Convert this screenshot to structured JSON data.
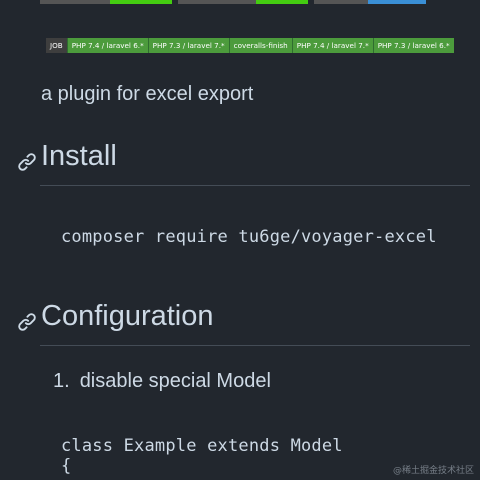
{
  "job_strip": {
    "label": "JOB",
    "items": [
      "PHP 7.4 / laravel 6.*",
      "PHP 7.3 / laravel 7.*",
      "coveralls-finish",
      "PHP 7.4 / laravel 7.*",
      "PHP 7.3 / laravel 6.*"
    ]
  },
  "description": "a plugin for excel export",
  "sections": {
    "install": {
      "title": "Install",
      "code": "composer require tu6ge/voyager-excel"
    },
    "configuration": {
      "title": "Configuration",
      "steps": [
        {
          "number": "1.",
          "text": "disable special Model"
        }
      ],
      "code_lines": [
        "class Example extends Model",
        "{"
      ]
    }
  },
  "watermark": "@稀土掘金技术社区",
  "colors": {
    "background": "#22272e",
    "text": "#cdd9e5",
    "badge_green": "#4c9b3c",
    "badge_gray": "#3e3e3e",
    "divider": "#444c56"
  }
}
